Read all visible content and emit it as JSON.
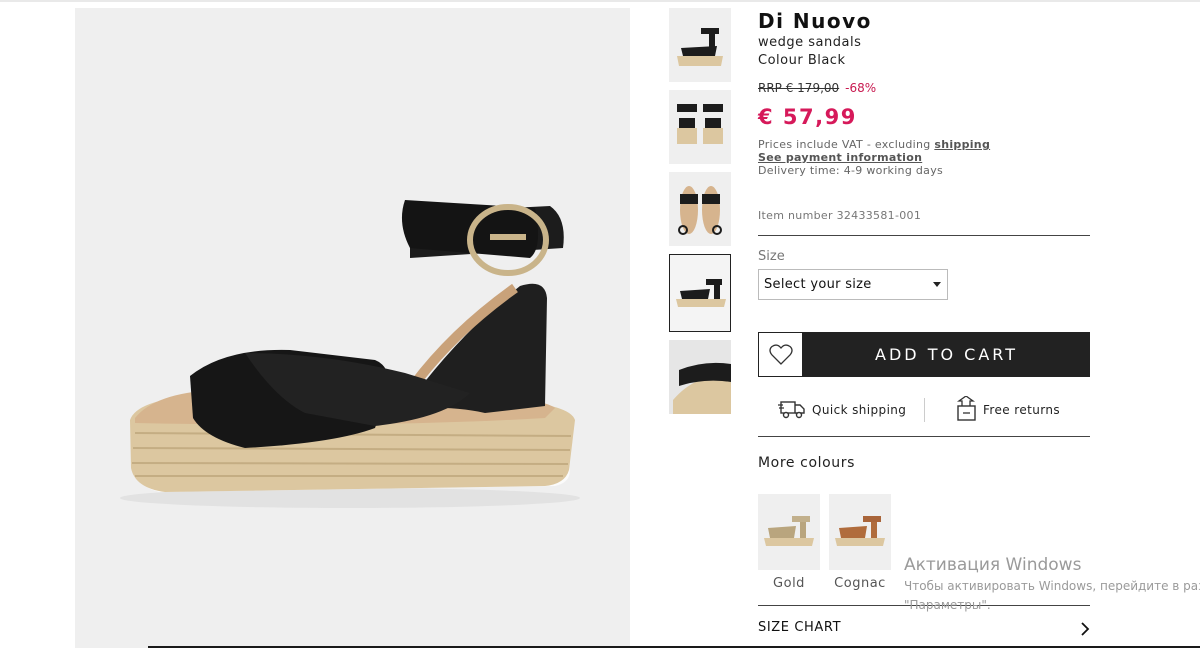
{
  "product": {
    "brand": "Di Nuovo",
    "subtitle": "wedge sandals",
    "colour": "Colour Black",
    "rrp": "RRP € 179,00",
    "discount": "-68%",
    "price": "€ 57,99",
    "vat_text": "Prices include VAT - excluding ",
    "shipping_link": "shipping",
    "payment_link": "See payment information",
    "delivery": "Delivery time: 4-9 working days",
    "item_number": "Item number 32433581-001"
  },
  "size": {
    "label": "Size",
    "selected": "Select your size"
  },
  "actions": {
    "add_to_cart": "ADD TO CART",
    "wishlist_icon": "heart-icon"
  },
  "perks": {
    "quick_shipping": "Quick shipping",
    "free_returns": "Free returns"
  },
  "more_colours": {
    "title": "More colours",
    "items": [
      {
        "label": "Gold"
      },
      {
        "label": "Cognac"
      }
    ]
  },
  "size_chart": {
    "label": "SIZE CHART"
  },
  "watermark": {
    "title": "Активация Windows",
    "line": "Чтобы активировать Windows, перейдите в раздел",
    "line2": "\"Параметры\"."
  },
  "colors": {
    "accent_price": "#d6195a",
    "cart_bg": "#222222",
    "image_bg": "#efefef"
  }
}
